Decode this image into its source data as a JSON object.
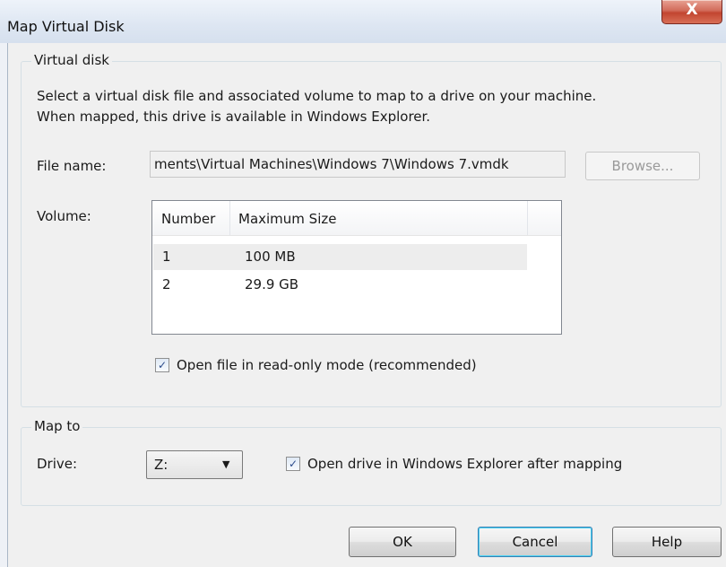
{
  "window": {
    "title": "Map Virtual Disk",
    "close_label": "X"
  },
  "virtual_disk": {
    "legend": "Virtual disk",
    "description_line1": "Select a virtual disk file and associated volume to map to a drive on your machine.",
    "description_line2": "When mapped, this drive is available in Windows Explorer.",
    "file_name_label": "File name:",
    "file_name_value": "ments\\Virtual Machines\\Windows 7\\Windows 7.vmdk",
    "browse_label": "Browse...",
    "volume_label": "Volume:",
    "volume_table": {
      "columns": [
        "Number",
        "Maximum Size"
      ],
      "rows": [
        {
          "number": "1",
          "size": "100 MB"
        },
        {
          "number": "2",
          "size": "29.9 GB"
        }
      ]
    },
    "readonly_checkbox_label": "Open file in read-only mode (recommended)",
    "readonly_checked": true
  },
  "map_to": {
    "legend": "Map to",
    "drive_label": "Drive:",
    "drive_value": "Z:",
    "open_explorer_label": "Open drive in Windows Explorer after mapping",
    "open_explorer_checked": true
  },
  "buttons": {
    "ok": "OK",
    "cancel": "Cancel",
    "help": "Help"
  },
  "icons": {
    "check": "✓",
    "dropdown": "▼"
  }
}
